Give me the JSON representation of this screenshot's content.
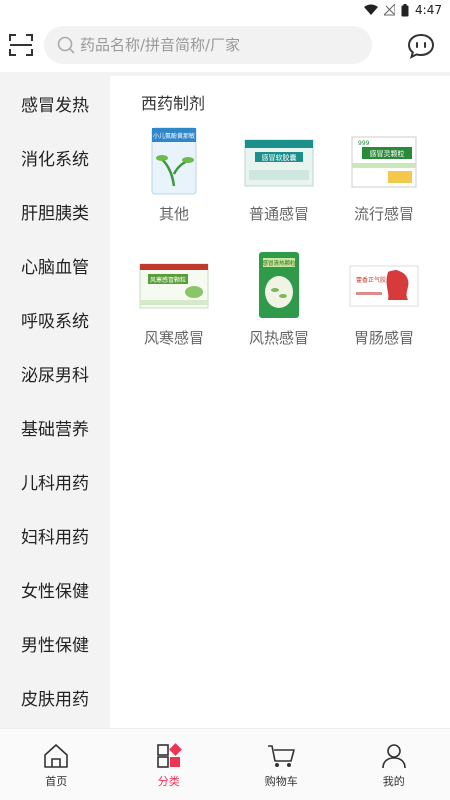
{
  "status_bar": {
    "time": "4:47"
  },
  "search": {
    "placeholder": "药品名称/拼音简称/厂家",
    "value": ""
  },
  "sidebar": {
    "items": [
      {
        "label": "感冒发热"
      },
      {
        "label": "消化系统"
      },
      {
        "label": "肝胆胰类"
      },
      {
        "label": "心脑血管"
      },
      {
        "label": "呼吸系统"
      },
      {
        "label": "泌尿男科"
      },
      {
        "label": "基础营养"
      },
      {
        "label": "儿科用药"
      },
      {
        "label": "妇科用药"
      },
      {
        "label": "女性保健"
      },
      {
        "label": "男性保健"
      },
      {
        "label": "皮肤用药"
      }
    ]
  },
  "content": {
    "section_title": "西药制剂",
    "products": [
      {
        "name": "其他",
        "box_text": "小儿氨酚黄那敏"
      },
      {
        "name": "普通感冒",
        "box_text": "感冒软胶囊"
      },
      {
        "name": "流行感冒",
        "box_text": "感冒灵颗粒",
        "brand": "999"
      },
      {
        "name": "风寒感冒",
        "box_text": "风寒感冒颗粒"
      },
      {
        "name": "风热感冒",
        "box_text": "感冒清热颗粒"
      },
      {
        "name": "胃肠感冒",
        "box_text": "藿香正气胶囊"
      }
    ]
  },
  "tabbar": {
    "items": [
      {
        "label": "首页",
        "icon": "home-icon"
      },
      {
        "label": "分类",
        "icon": "category-icon",
        "active": true
      },
      {
        "label": "购物车",
        "icon": "cart-icon"
      },
      {
        "label": "我的",
        "icon": "profile-icon"
      }
    ]
  },
  "colors": {
    "accent": "#ee3355",
    "sidebar_bg": "#f3f3f3",
    "text": "#333333",
    "muted": "#666666"
  }
}
